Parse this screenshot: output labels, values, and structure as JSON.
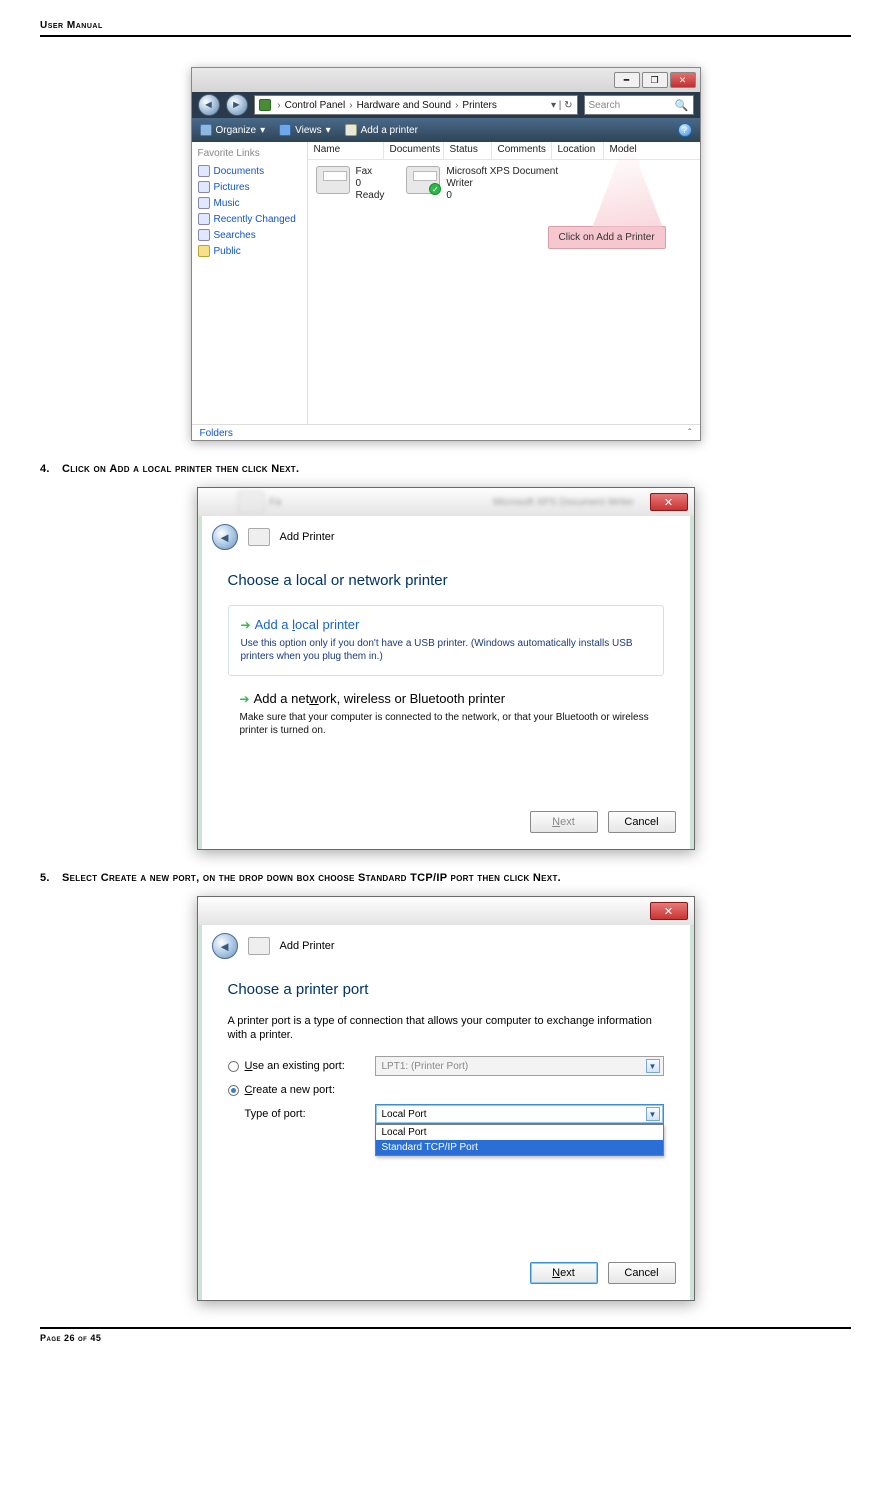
{
  "doc": {
    "header": "User Manual",
    "footer": "Page 26 of 45"
  },
  "steps": {
    "s4": {
      "num": "4.",
      "pre": "Click on ",
      "bold1": "Add a local printer",
      "mid": " then click ",
      "bold2": "Next",
      "post": "."
    },
    "s5": {
      "num": "5.",
      "pre": "Select ",
      "bold1": "Create a new port",
      "mid": ", on the drop down box choose ",
      "bold2": "Standard TCP/IP port",
      "mid2": " then click ",
      "bold3": "Next",
      "post": "."
    }
  },
  "fig1": {
    "crumbs": [
      "Control Panel",
      "Hardware and Sound",
      "Printers"
    ],
    "search_placeholder": "Search",
    "toolbar": {
      "organize": "Organize",
      "views": "Views",
      "add": "Add a printer"
    },
    "side_header": "Favorite Links",
    "side_items": [
      "Documents",
      "Pictures",
      "Music",
      "Recently Changed",
      "Searches",
      "Public"
    ],
    "columns": [
      "Name",
      "Documents",
      "Status",
      "Comments",
      "Location",
      "Model"
    ],
    "printer1": {
      "name": "Fax",
      "docs": "0",
      "status": "Ready"
    },
    "printer2": {
      "name": "Microsoft XPS Document Writer",
      "docs": "0"
    },
    "callout": "Click on Add a Printer",
    "folders": "Folders"
  },
  "fig2": {
    "title": "Add Printer",
    "behind": "Microsoft XPS Document Writer",
    "heading": "Choose a local or network printer",
    "opt1": {
      "title": "Add a local printer",
      "desc": "Use this option only if you don't have a USB printer. (Windows automatically installs USB printers when you plug them in.)"
    },
    "opt2": {
      "title": "Add a network, wireless or Bluetooth printer",
      "desc": "Make sure that your computer is connected to the network, or that your Bluetooth or wireless printer is turned on."
    },
    "btn_next": "Next",
    "btn_cancel": "Cancel"
  },
  "fig3": {
    "title": "Add Printer",
    "heading": "Choose a printer port",
    "desc": "A printer port is a type of connection that allows your computer to exchange information with a printer.",
    "radio1": "Use an existing port:",
    "radio2": "Create a new port:",
    "combo1": "LPT1: (Printer Port)",
    "type_label": "Type of port:",
    "combo2_value": "Local Port",
    "dropdown": [
      "Local Port",
      "Standard TCP/IP Port"
    ],
    "btn_next": "Next",
    "btn_cancel": "Cancel"
  }
}
